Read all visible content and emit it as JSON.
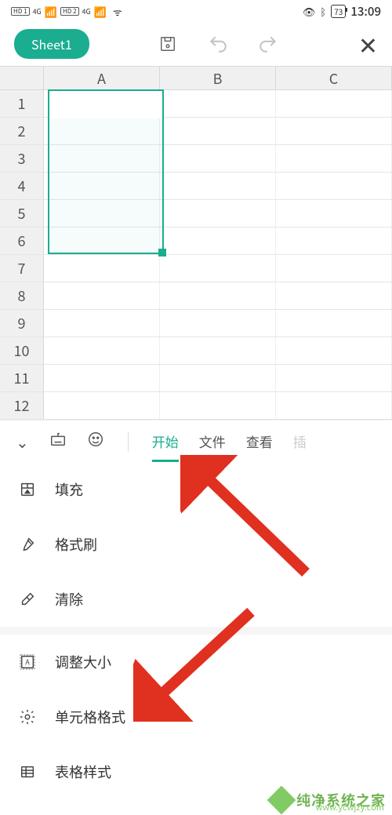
{
  "status_bar": {
    "hd1": "HD 1",
    "hd2": "HD 2",
    "net1": "4G",
    "net2": "4G",
    "battery": "73",
    "time": "13:09"
  },
  "toolbar": {
    "sheet_name": "Sheet1"
  },
  "sheet": {
    "columns": [
      "A",
      "B",
      "C"
    ],
    "rows": [
      "1",
      "2",
      "3",
      "4",
      "5",
      "6",
      "7",
      "8",
      "9",
      "10",
      "11",
      "12"
    ],
    "selection": "A1:A6"
  },
  "panel": {
    "tabs": {
      "start": "开始",
      "file": "文件",
      "view": "查看",
      "more": "插"
    }
  },
  "menu": {
    "group1": [
      {
        "key": "fill",
        "label": "填充"
      },
      {
        "key": "format-brush",
        "label": "格式刷"
      },
      {
        "key": "clear",
        "label": "清除"
      }
    ],
    "group2": [
      {
        "key": "resize",
        "label": "调整大小"
      },
      {
        "key": "cell-format",
        "label": "单元格格式"
      },
      {
        "key": "table-style",
        "label": "表格样式"
      }
    ]
  },
  "watermark": {
    "name": "纯净系统之家",
    "url": "www.ycwjzy.com"
  }
}
